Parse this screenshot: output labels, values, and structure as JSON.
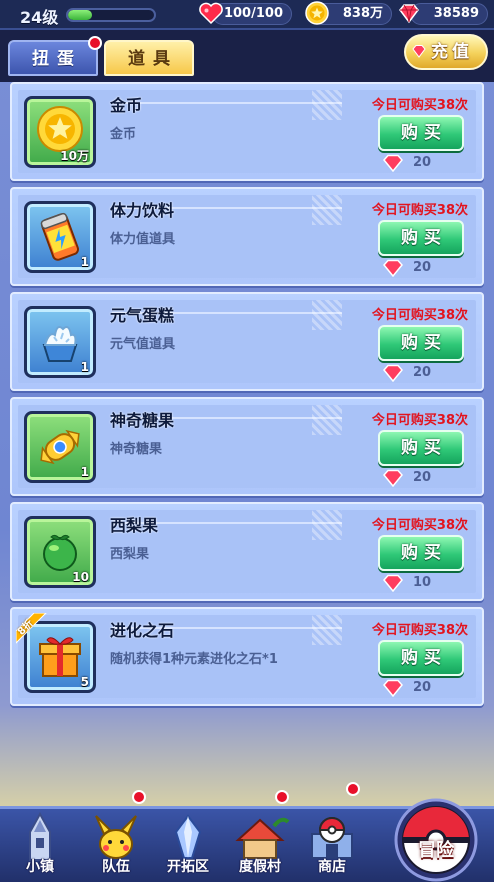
{
  "status_bar": {
    "level": "24级",
    "exp_progress": 0.28,
    "stamina": "100/100",
    "gold": "838万",
    "diamonds": "38589"
  },
  "tabs": {
    "gacha": "扭蛋",
    "items": "道具",
    "recharge": "充值"
  },
  "items": [
    {
      "name": "金币",
      "desc": "金币",
      "count": "10万",
      "limit": "今日可购买38次",
      "buy": "购买",
      "price": "20",
      "icon": "gold-coin-icon"
    },
    {
      "name": "体力饮料",
      "desc": "体力值道具",
      "count": "1",
      "limit": "今日可购买38次",
      "buy": "购买",
      "price": "20",
      "icon": "energy-drink-icon"
    },
    {
      "name": "元气蛋糕",
      "desc": "元气值道具",
      "count": "1",
      "limit": "今日可购买38次",
      "buy": "购买",
      "price": "20",
      "icon": "cake-icon"
    },
    {
      "name": "神奇糖果",
      "desc": "神奇糖果",
      "count": "1",
      "limit": "今日可购买38次",
      "buy": "购买",
      "price": "20",
      "icon": "candy-icon"
    },
    {
      "name": "西梨果",
      "desc": "西梨果",
      "count": "10",
      "limit": "今日可购买38次",
      "buy": "购买",
      "price": "10",
      "icon": "pear-fruit-icon"
    },
    {
      "name": "进化之石",
      "desc": "随机获得1种元素进化之石*1",
      "count": "5",
      "limit": "今日可购买38次",
      "buy": "购买",
      "price": "20",
      "icon": "gift-box-icon",
      "badge": "8折"
    }
  ],
  "nav": {
    "town": "小镇",
    "team": "队伍",
    "explore": "开拓区",
    "resort": "度假村",
    "shop": "商店",
    "adventure": "冒险"
  },
  "colors": {
    "buy_button": "#2fc877",
    "limit_text": "#e2141f",
    "card_bg": "#b9d1ff"
  }
}
